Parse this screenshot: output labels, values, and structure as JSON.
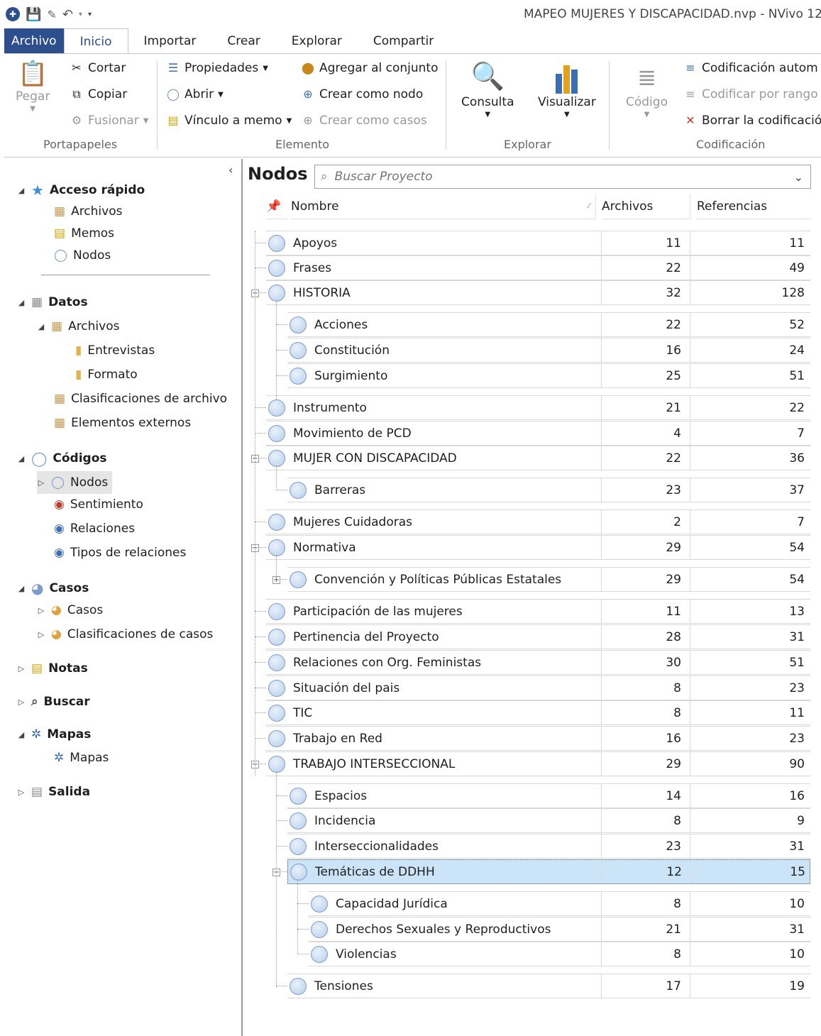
{
  "window": {
    "title": "MAPEO MUJERES Y DISCAPACIDAD.nvp - NVivo 12"
  },
  "ribbon": {
    "tabs": [
      "Archivo",
      "Inicio",
      "Importar",
      "Crear",
      "Explorar",
      "Compartir"
    ],
    "clipboard": {
      "paste": "Pegar",
      "cut": "Cortar",
      "copy": "Copiar",
      "merge": "Fusionar",
      "group": "Portapapeles"
    },
    "item": {
      "properties": "Propiedades",
      "open": "Abrir",
      "memo_link": "Vínculo a memo",
      "add_set": "Agregar al conjunto",
      "create_node": "Crear como nodo",
      "create_cases": "Crear como casos",
      "group": "Elemento"
    },
    "explore": {
      "query": "Consulta",
      "visualize": "Visualizar",
      "group": "Explorar"
    },
    "coding": {
      "code": "Código",
      "auto": "Codificación autom",
      "range": "Codificar por rango",
      "clear": "Borrar la codificació",
      "group": "Codificación"
    }
  },
  "nav": {
    "quick_access": "Acceso rápido",
    "qa_files": "Archivos",
    "qa_memos": "Memos",
    "qa_nodes": "Nodos",
    "data": "Datos",
    "files": "Archivos",
    "interviews": "Entrevistas",
    "format": "Formato",
    "file_class": "Clasificaciones de archivo",
    "external": "Elementos externos",
    "codes": "Códigos",
    "nodes": "Nodos",
    "sentiment": "Sentimiento",
    "relations": "Relaciones",
    "rel_types": "Tipos de relaciones",
    "cases_hdr": "Casos",
    "cases": "Casos",
    "case_class": "Clasificaciones de casos",
    "notes": "Notas",
    "search": "Buscar",
    "maps_hdr": "Mapas",
    "maps": "Mapas",
    "output": "Salida"
  },
  "main": {
    "title": "Nodos",
    "search_placeholder": "Buscar Proyecto",
    "columns": {
      "name": "Nombre",
      "files": "Archivos",
      "refs": "Referencias"
    },
    "rows": [
      {
        "name": "Apoyos",
        "files": "11",
        "refs": "11"
      },
      {
        "name": "Frases",
        "files": "22",
        "refs": "49"
      },
      {
        "name": "HISTORIA",
        "files": "32",
        "refs": "128"
      },
      {
        "name": "Acciones",
        "files": "22",
        "refs": "52"
      },
      {
        "name": "Constitución",
        "files": "16",
        "refs": "24"
      },
      {
        "name": "Surgimiento",
        "files": "25",
        "refs": "51"
      },
      {
        "name": "Instrumento",
        "files": "21",
        "refs": "22"
      },
      {
        "name": "Movimiento de PCD",
        "files": "4",
        "refs": "7"
      },
      {
        "name": "MUJER CON DISCAPACIDAD",
        "files": "22",
        "refs": "36"
      },
      {
        "name": "Barreras",
        "files": "23",
        "refs": "37"
      },
      {
        "name": "Mujeres Cuidadoras",
        "files": "2",
        "refs": "7"
      },
      {
        "name": "Normativa",
        "files": "29",
        "refs": "54"
      },
      {
        "name": "Convención y Políticas Públicas Estatales",
        "files": "29",
        "refs": "54"
      },
      {
        "name": "Participación de las mujeres",
        "files": "11",
        "refs": "13"
      },
      {
        "name": "Pertinencia del Proyecto",
        "files": "28",
        "refs": "31"
      },
      {
        "name": "Relaciones con Org. Feministas",
        "files": "30",
        "refs": "51"
      },
      {
        "name": "Situación del pais",
        "files": "8",
        "refs": "23"
      },
      {
        "name": "TIC",
        "files": "8",
        "refs": "11"
      },
      {
        "name": "Trabajo en Red",
        "files": "16",
        "refs": "23"
      },
      {
        "name": "TRABAJO INTERSECCIONAL",
        "files": "29",
        "refs": "90"
      },
      {
        "name": "Espacios",
        "files": "14",
        "refs": "16"
      },
      {
        "name": "Incidencia",
        "files": "8",
        "refs": "9"
      },
      {
        "name": "Interseccionalidades",
        "files": "23",
        "refs": "31"
      },
      {
        "name": "Temáticas de DDHH",
        "files": "12",
        "refs": "15"
      },
      {
        "name": "Capacidad Jurídica",
        "files": "8",
        "refs": "10"
      },
      {
        "name": "Derechos Sexuales y Reproductivos",
        "files": "21",
        "refs": "31"
      },
      {
        "name": "Violencias",
        "files": "8",
        "refs": "10"
      },
      {
        "name": "Tensiones",
        "files": "17",
        "refs": "19"
      }
    ]
  },
  "colors": {
    "file_tab": "#2e4f8d",
    "selection": "#cce4f7"
  }
}
